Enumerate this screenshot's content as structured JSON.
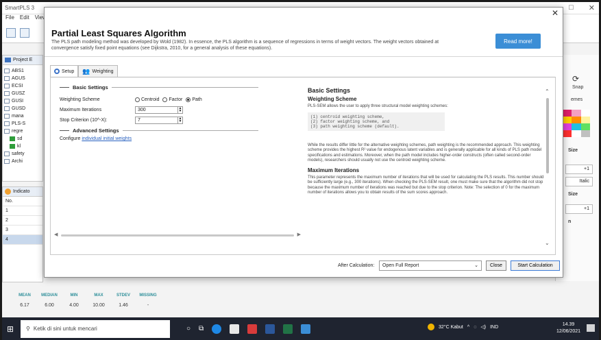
{
  "background_app": {
    "title": "SmartPLS 3",
    "menu": [
      "File",
      "Edit",
      "View"
    ],
    "project_panel_title": "Project E",
    "tree_items": [
      "ABS1",
      "AGUS",
      "ECSI",
      "GUSZ",
      "GUSI",
      "GUSD",
      "mana",
      "PLS-S",
      "regre",
      "sd",
      "kl",
      "safety",
      "Archi"
    ],
    "indicators_title": "Indicato",
    "indicators_header": "No.",
    "indicator_rows": [
      "1",
      "2",
      "3",
      "4"
    ],
    "stats_headers": [
      "MEAN",
      "MEDIAN",
      "MIN",
      "MAX",
      "STDEV",
      "MISSING"
    ],
    "stats_values": [
      "6.17",
      "6.00",
      "4.00",
      "10.00",
      "1.46",
      "-"
    ],
    "right_panel": {
      "snap_label": "Snap",
      "themes_label": "emes",
      "size_label": "Size",
      "plus1": "+1",
      "italic": "Italic",
      "size2_label": "Size",
      "plus1b": "+1",
      "n_label": "n"
    }
  },
  "dialog": {
    "title": "Partial Least Squares Algorithm",
    "description": "The PLS path modeling method was developed by Wold (1982). In essence, the PLS algorithm is a sequence of regressions in terms of weight vectors. The weight vectors obtained at convergence satisfy fixed point equations (see Dijkstra, 2010, for a general analysis of these equations).",
    "read_more": "Read more!",
    "tabs": [
      {
        "label": "Setup",
        "icon": "setup-icon"
      },
      {
        "label": "Weighting",
        "icon": "weighting-icon"
      }
    ],
    "basic_settings_heading": "Basic Settings",
    "weighting_scheme_label": "Weighting Scheme",
    "weighting_options": [
      "Centroid",
      "Factor",
      "Path"
    ],
    "weighting_selected": "Path",
    "max_iterations_label": "Maximum Iterations",
    "max_iterations_value": "300",
    "stop_criterion_label": "Stop Criterion (10^-X):",
    "stop_criterion_value": "7",
    "advanced_settings_heading": "Advanced Settings",
    "configure_text": "Configure",
    "configure_link": "individual initial weights",
    "help": {
      "title": "Basic Settings",
      "subtitle": "Weighting Scheme",
      "intro": "PLS-SEM allows the user to apply three structural model weighting schemes:",
      "code_lines": [
        "(1) centroid weighting scheme,",
        "(2) factor weighting scheme, and",
        "(3) path weighting scheme (default)."
      ],
      "para1": "While the results differ little for the alternative weighting schemes, path weighting is the recommended approach. This weighting scheme provides the highest R² value for endogenous latent variables and is generally applicable for all kinds of PLS path model specifications and estimations. Moreover, when the path model includes higher-order constructs (often called second-order models), researchers should usually not use the centroid weighting scheme.",
      "subtitle2": "Maximum Iterations",
      "para2": "This parameter represents the maximum number of iterations that will be used for calculating the PLS results. This number should be sufficiently large (e.g., 300 iterations). When checking the PLS-SEM result, one must make sure that the algorithm did not stop because the maximum number of iterations was reached but due to the stop criterion. Note: The selection of 0 for the maximum number of iterations allows you to obtain results of the sum scores approach."
    },
    "after_calc_label": "After Calculation:",
    "after_calc_value": "Open Full Report",
    "close_button": "Close",
    "start_button": "Start Calculation"
  },
  "taskbar": {
    "search_placeholder": "Ketik di sini untuk mencari",
    "weather": "32°C Kabut",
    "lang": "IND",
    "time": "14.39",
    "date": "12/06/2021"
  },
  "colors": {
    "accent": "#3b8ed6",
    "taskbar": "#1f2430",
    "stat_header": "#2e8f9a"
  }
}
